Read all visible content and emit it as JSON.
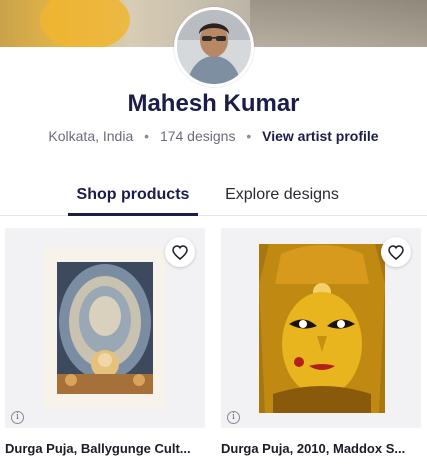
{
  "artist": {
    "name": "Mahesh Kumar",
    "location": "Kolkata, India",
    "designs": "174 designs",
    "profile_link": "View artist profile",
    "separator": "•"
  },
  "tabs": [
    {
      "label": "Shop products",
      "active": true
    },
    {
      "label": "Explore designs",
      "active": false
    }
  ],
  "products": [
    {
      "title": "Durga Puja, Ballygunge Cult...",
      "favorite_icon": "heart-outline-icon",
      "info_icon": "info-icon",
      "info_glyph": "i"
    },
    {
      "title": "Durga Puja, 2010, Maddox S...",
      "favorite_icon": "heart-outline-icon",
      "info_icon": "info-icon",
      "info_glyph": "i"
    }
  ],
  "colors": {
    "accent": "#1c1c4a",
    "card_bg": "#f2f2f4",
    "muted_text": "#6b6b80"
  }
}
